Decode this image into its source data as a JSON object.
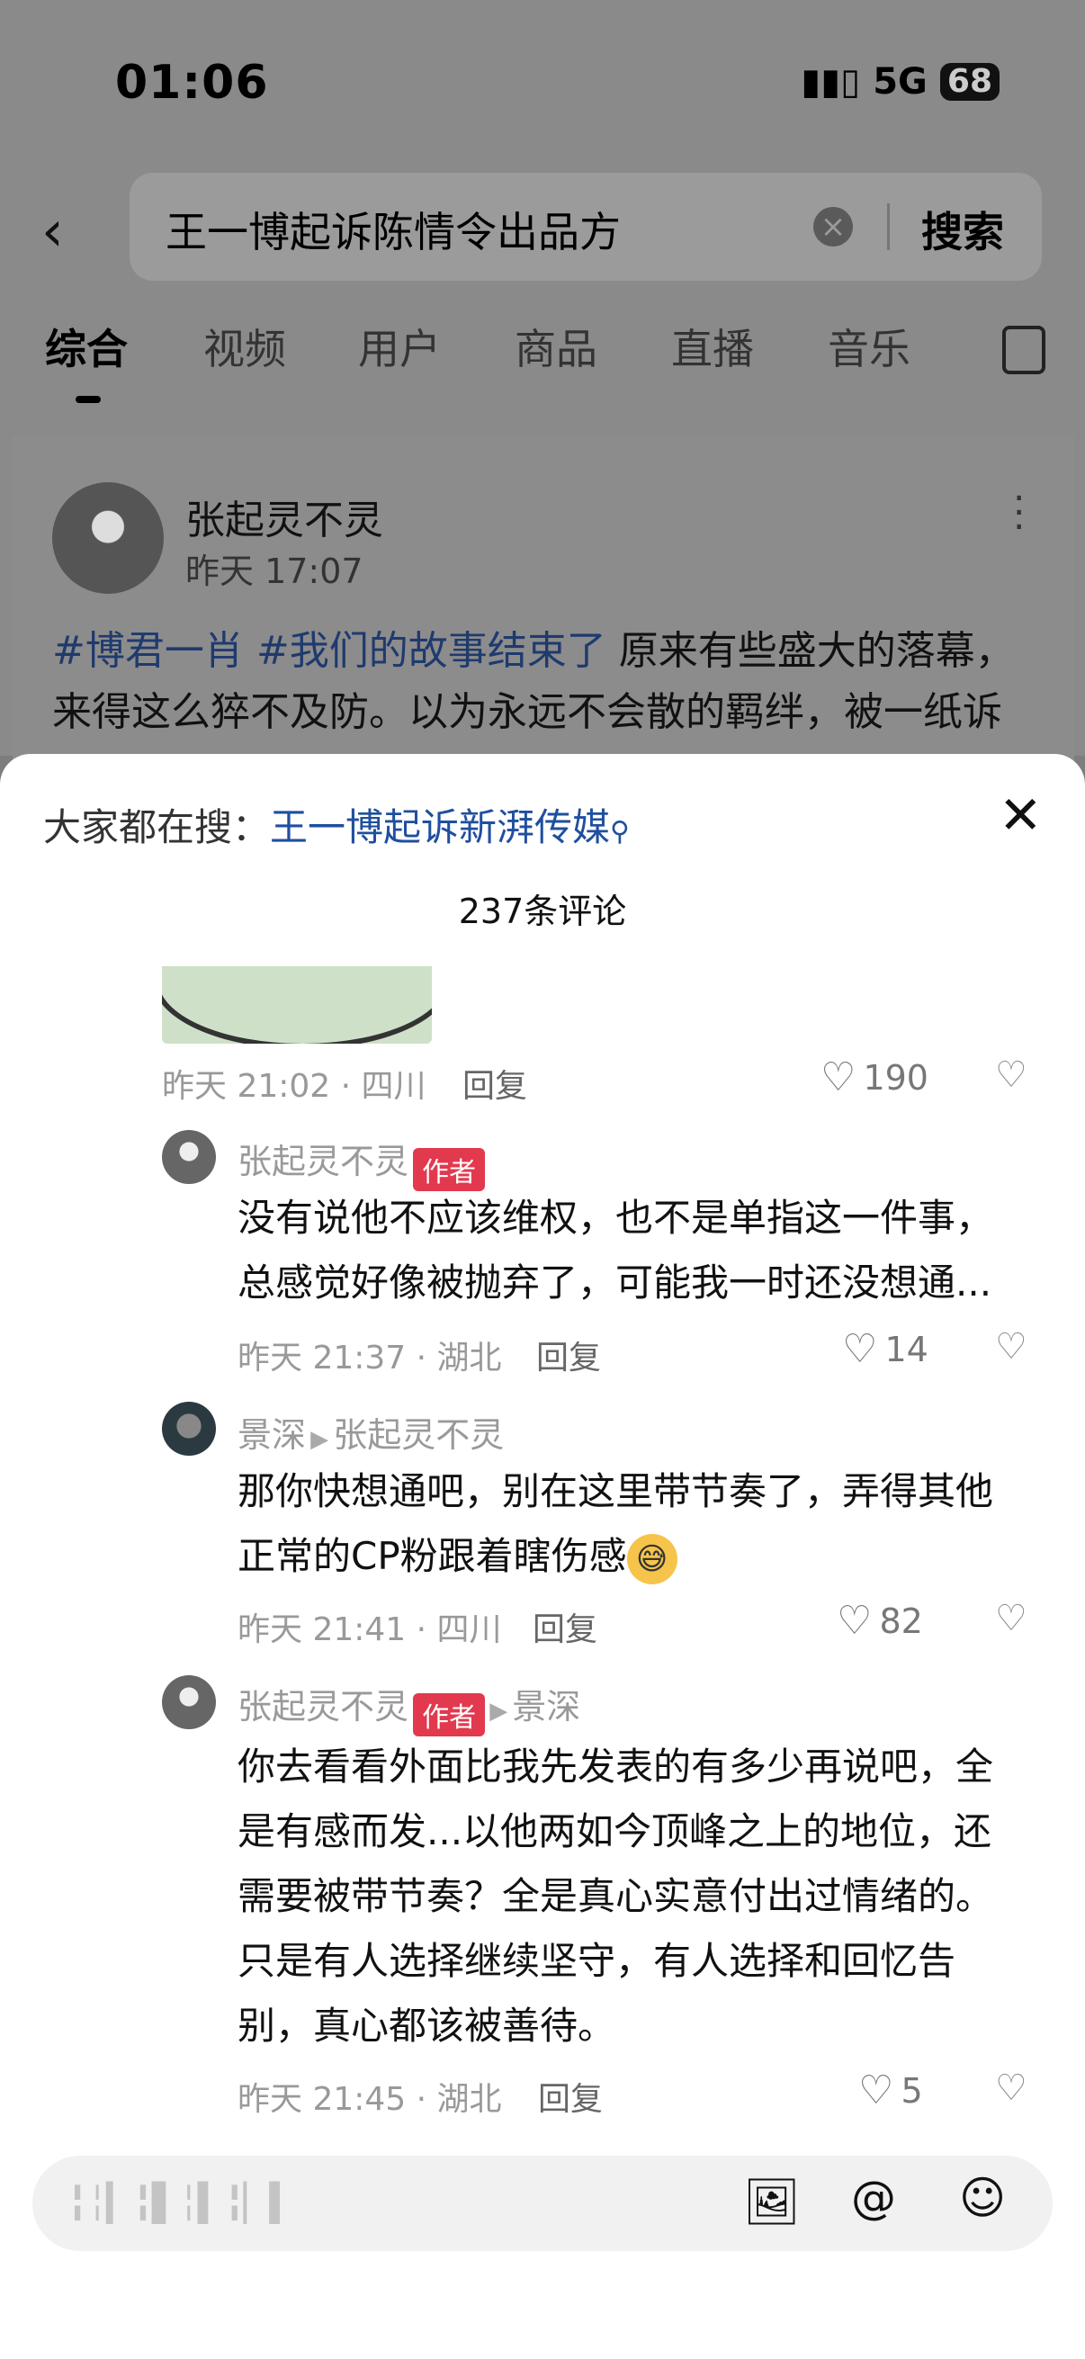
{
  "status": {
    "time": "01:06",
    "network": "5G",
    "battery": "68"
  },
  "search": {
    "query": "王一博起诉陈情令出品方",
    "button": "搜索"
  },
  "tabs": [
    "综合",
    "视频",
    "用户",
    "商品",
    "直播",
    "音乐"
  ],
  "post": {
    "author": "张起灵不灵",
    "time": "昨天 17:07",
    "hashtag1": "#博君一肖",
    "hashtag2": "#我们的故事结束了",
    "text1": " 原来有些盛大的落幕，",
    "text2": "来得这么猝不及防。以为永远不会散的羁绊，被一纸诉"
  },
  "sheet": {
    "trending_prefix": "大家都在搜：",
    "trending_link": "王一博起诉新湃传媒",
    "comment_count": "237条评论"
  },
  "comments": [
    {
      "time_loc": "昨天 21:02 · 四川",
      "reply": "回复",
      "likes": "190"
    },
    {
      "user": "张起灵不灵",
      "badge": "作者",
      "text1": "没有说他不应该维权，也不是单指这一件事，",
      "text2": "总感觉好像被抛弃了，可能我一时还没想通...",
      "time_loc": "昨天 21:37 · 湖北",
      "reply": "回复",
      "likes": "14"
    },
    {
      "user": "景深",
      "reply_to": "张起灵不灵",
      "text1": "那你快想通吧，别在这里带节奏了，弄得其他",
      "text2": "正常的CP粉跟着瞎伤感",
      "time_loc": "昨天 21:41 · 四川",
      "reply": "回复",
      "likes": "82"
    },
    {
      "user": "张起灵不灵",
      "badge": "作者",
      "reply_to": "景深",
      "text1": "你去看看外面比我先发表的有多少再说吧，全",
      "text2": "是有感而发...以他两如今顶峰之上的地位，还",
      "text3": "需要被带节奏？全是真心实意付出过情绪的。",
      "text4": "只是有人选择继续坚守，有人选择和回忆告",
      "text5": "别，真心都该被善待。",
      "time_loc": "昨天 21:45 · 湖北",
      "reply": "回复",
      "likes": "5"
    }
  ],
  "input": {
    "placeholder": "╏╎▎╏▌╎▍╏▏▍"
  },
  "icons": {
    "back": "back-arrow-icon",
    "clear": "clear-icon",
    "close": "close-icon",
    "heart": "heart-icon",
    "dislike": "broken-heart-icon",
    "image": "image-icon",
    "at": "at-icon",
    "emoji": "emoji-icon"
  }
}
